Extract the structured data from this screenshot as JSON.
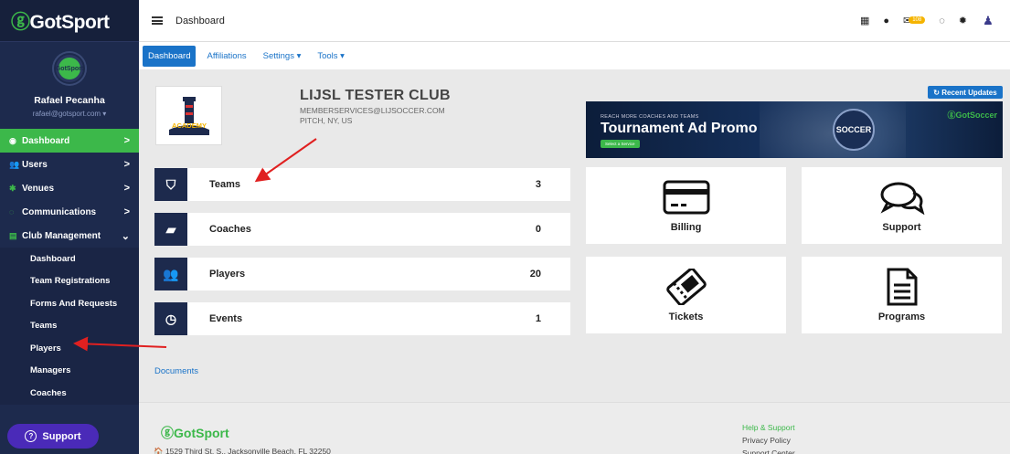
{
  "sidebar": {
    "logo_prefix": "ⓖ",
    "logo_text": "GotSport",
    "avatar_text": "GotSport",
    "user_name": "Rafael Pecanha",
    "user_email": "rafael@gotsport.com ▾",
    "nav": [
      {
        "label": "Dashboard",
        "chev": ">"
      },
      {
        "label": "Users",
        "chev": ">"
      },
      {
        "label": "Venues",
        "chev": ">"
      },
      {
        "label": "Communications",
        "chev": ">"
      },
      {
        "label": "Club Management",
        "chev": "⌄"
      }
    ],
    "sub": [
      "Dashboard",
      "Team Registrations",
      "Forms And Requests",
      "Teams",
      "Players",
      "Managers",
      "Coaches"
    ],
    "support_label": "Support"
  },
  "topbar": {
    "title": "Dashboard",
    "badge": "108"
  },
  "tabs": [
    {
      "label": "Dashboard"
    },
    {
      "label": "Affiliations"
    },
    {
      "label": "Settings ▾"
    },
    {
      "label": "Tools ▾"
    }
  ],
  "club": {
    "name": "LIJSL TESTER CLUB",
    "email": "MEMBERSERVICES@LIJSOCCER.COM",
    "location": "PITCH, NY, US",
    "logo_text": "ACADEMY"
  },
  "stats": [
    {
      "label": "Teams",
      "value": "3"
    },
    {
      "label": "Coaches",
      "value": "0"
    },
    {
      "label": "Players",
      "value": "20"
    },
    {
      "label": "Events",
      "value": "1"
    }
  ],
  "documents_label": "Documents",
  "recent_updates_label": "↻ Recent Updates",
  "ad": {
    "small": "REACH MORE COACHES AND TEAMS",
    "big": "Tournament Ad Promo",
    "button": "Select a Service",
    "badge": "SOCCER",
    "brand": "ⓖGotSoccer"
  },
  "cards": [
    {
      "label": "Billing"
    },
    {
      "label": "Support"
    },
    {
      "label": "Tickets"
    },
    {
      "label": "Programs"
    }
  ],
  "footer": {
    "logo": "ⓖGotSport",
    "address": "🏠 1529 Third St. S., Jacksonville Beach, FL 32250",
    "links": [
      "Help & Support",
      "Privacy Policy",
      "Support Center"
    ]
  },
  "colors": {
    "sidebar": "#1d2a4d",
    "accent_green": "#3cb84a",
    "link_blue": "#1a73c8",
    "annotation_red": "#e02020"
  }
}
